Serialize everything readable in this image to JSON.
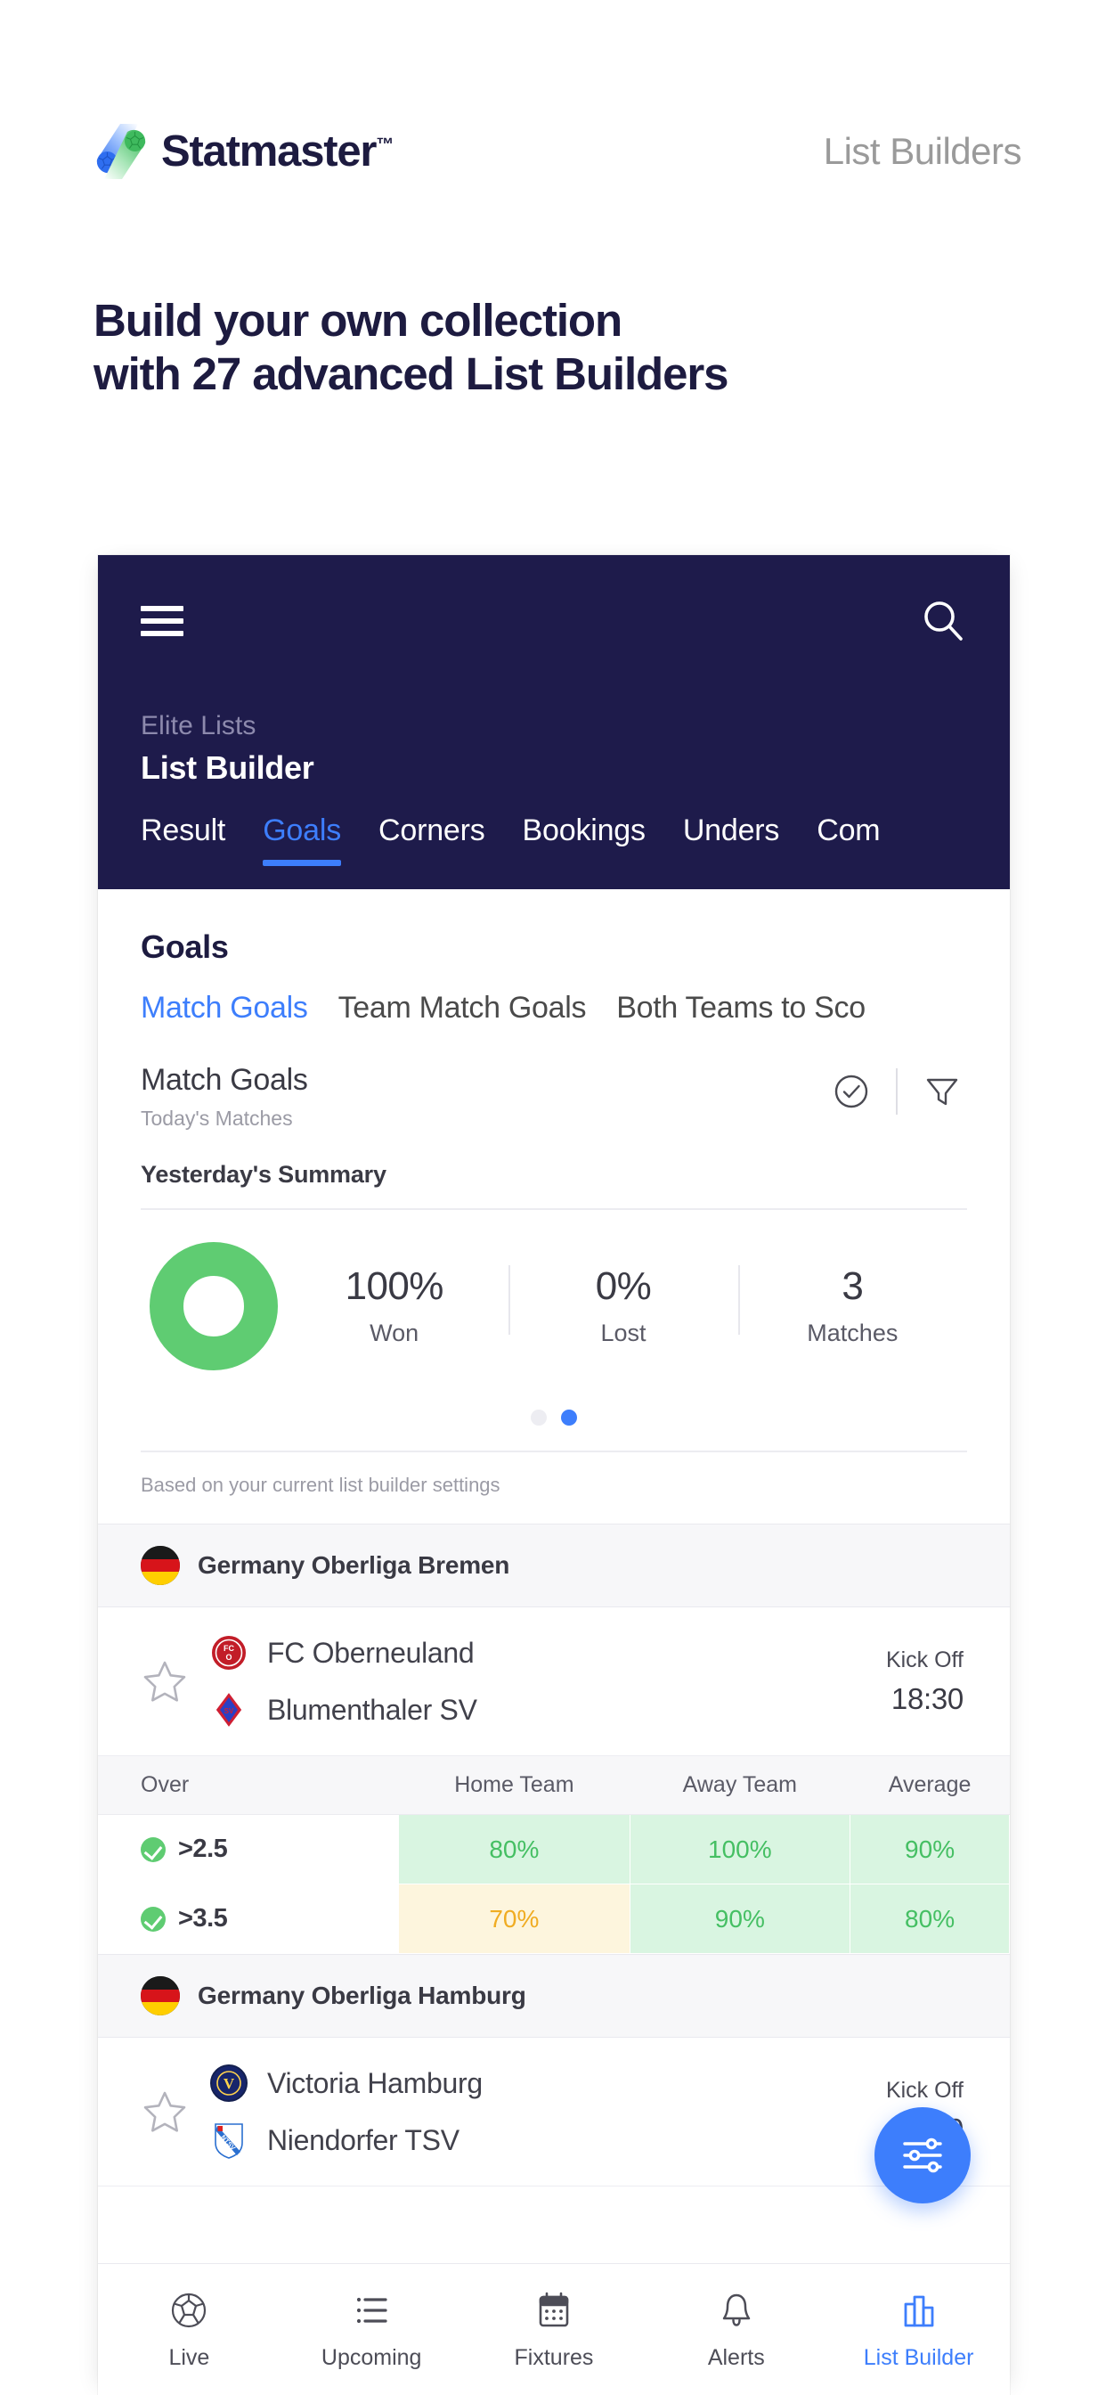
{
  "promo": {
    "brand_name": "Statmaster",
    "brand_tm": "™",
    "section_label": "List Builders",
    "headline_line1": "Build your own collection",
    "headline_line2": "with 27 advanced List Builders",
    "brand_color_blue": "#3d7efc",
    "brand_color_green": "#4ec06a",
    "text_color": "#1d1b40"
  },
  "app": {
    "menu_icon": "hamburger-menu-icon",
    "search_icon": "search-icon",
    "eyebrow": "Elite Lists",
    "title": "List Builder",
    "accent": "#3d7efc",
    "header_bg": "#1e1b4b",
    "tabs": [
      {
        "label": "Result",
        "active": false
      },
      {
        "label": "Goals",
        "active": true
      },
      {
        "label": "Corners",
        "active": false
      },
      {
        "label": "Bookings",
        "active": false
      },
      {
        "label": "Unders",
        "active": false
      },
      {
        "label": "Com",
        "active": false
      }
    ]
  },
  "section": {
    "title": "Goals",
    "sub_tabs": [
      {
        "label": "Match Goals",
        "active": true
      },
      {
        "label": "Team Match Goals",
        "active": false
      },
      {
        "label": "Both Teams to Sco",
        "active": false
      }
    ],
    "list_heading": "Match Goals",
    "list_subheading": "Today's Matches",
    "check_icon": "check-circle-icon",
    "filter_icon": "funnel-filter-icon"
  },
  "summary": {
    "heading": "Yesterday's Summary",
    "footnote": "Based on your current list builder settings",
    "donut_percent": 100,
    "donut_color": "#5fcc72",
    "stats": [
      {
        "value": "100%",
        "label": "Won"
      },
      {
        "value": "0%",
        "label": "Lost"
      },
      {
        "value": "3",
        "label": "Matches"
      }
    ],
    "carousel": {
      "total": 2,
      "active_index": 1
    }
  },
  "leagues": [
    {
      "name": "Germany Oberliga Bremen",
      "flag": "germany-flag-icon",
      "match": {
        "star_icon": "favorite-star-icon",
        "home_team": "FC Oberneuland",
        "away_team": "Blumenthaler SV",
        "home_crest": "fc-oberneuland-crest-icon",
        "away_crest": "blumenthaler-sv-crest-icon",
        "kick_off_label": "Kick Off",
        "kick_off_time": "18:30"
      },
      "table": {
        "headers": [
          "Over",
          "Home Team",
          "Away Team",
          "Average"
        ],
        "rows": [
          {
            "over": ">2.5",
            "checked": true,
            "cells": [
              {
                "value": "80%",
                "state": "good"
              },
              {
                "value": "100%",
                "state": "good"
              },
              {
                "value": "90%",
                "state": "good"
              }
            ]
          },
          {
            "over": ">3.5",
            "checked": true,
            "cells": [
              {
                "value": "70%",
                "state": "warn"
              },
              {
                "value": "90%",
                "state": "good"
              },
              {
                "value": "80%",
                "state": "good"
              }
            ]
          }
        ]
      }
    },
    {
      "name": "Germany Oberliga Hamburg",
      "flag": "germany-flag-icon",
      "match": {
        "star_icon": "favorite-star-icon",
        "home_team": "Victoria Hamburg",
        "away_team": "Niendorfer TSV",
        "home_crest": "victoria-hamburg-crest-icon",
        "away_crest": "niendorfer-tsv-crest-icon",
        "kick_off_label": "Kick Off",
        "kick_off_time": "18:30"
      }
    }
  ],
  "fab": {
    "icon": "settings-sliders-icon",
    "color": "#3d7efc"
  },
  "bottom_nav": [
    {
      "label": "Live",
      "icon": "soccer-ball-icon",
      "active": false
    },
    {
      "label": "Upcoming",
      "icon": "list-icon",
      "active": false
    },
    {
      "label": "Fixtures",
      "icon": "calendar-icon",
      "active": false
    },
    {
      "label": "Alerts",
      "icon": "bell-icon",
      "active": false
    },
    {
      "label": "List Builder",
      "icon": "bar-chart-icon",
      "active": true
    }
  ],
  "colors": {
    "good_bg": "#d9f5e1",
    "good_text": "#45bf63",
    "warn_bg": "#fdf5dd",
    "warn_text": "#f0ac22"
  }
}
